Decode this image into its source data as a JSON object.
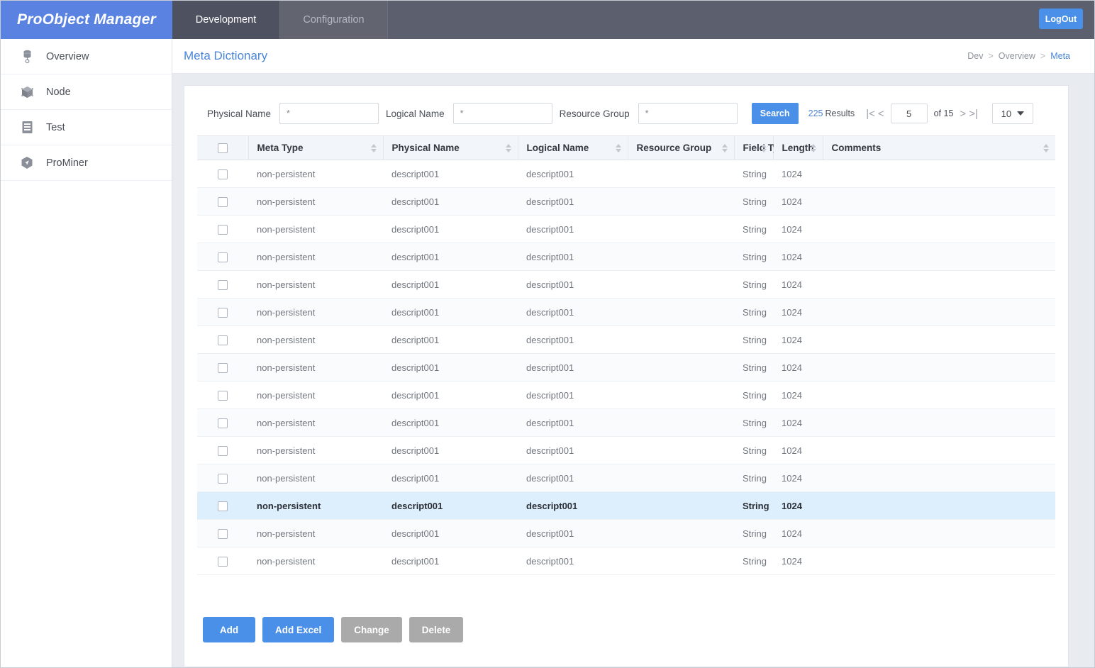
{
  "topbar": {
    "logo": "ProObject Manager",
    "tabs": [
      {
        "label": "Development",
        "active": true
      },
      {
        "label": "Configuration",
        "active": false
      }
    ],
    "logout_label": "LogOut",
    "accent_color": "#4a90e8",
    "logo_bg": "#5a82e0",
    "bar_bg": "#5b5f6e"
  },
  "sidebar": {
    "items": [
      {
        "label": "Overview",
        "icon": "database-icon"
      },
      {
        "label": "Node",
        "icon": "cube-icon"
      },
      {
        "label": "Test",
        "icon": "list-document-icon"
      },
      {
        "label": "ProMiner",
        "icon": "shield-icon"
      }
    ]
  },
  "content_header": {
    "title": "Meta Dictionary",
    "breadcrumb": [
      {
        "label": "Dev",
        "current": false
      },
      {
        "label": "Overview",
        "current": false
      },
      {
        "label": "Meta",
        "current": true
      }
    ],
    "separator": ">"
  },
  "filters": {
    "physical_name_label": "Physical Name",
    "physical_name_value": "*",
    "logical_name_label": "Logical Name",
    "logical_name_value": "*",
    "resource_group_label": "Resource Group",
    "resource_group_value": "*",
    "search_label": "Search"
  },
  "pagination": {
    "results_count": "225",
    "results_label": "Results",
    "first_icon": "|<",
    "prev_icon": "<",
    "page_value": "5",
    "of_label": "of 15",
    "total_pages": "15",
    "next_icon": ">",
    "last_icon": ">|",
    "page_size": "10"
  },
  "table": {
    "columns": [
      {
        "label": "Meta  Type",
        "sortable": true
      },
      {
        "label": "Physical  Name",
        "sortable": true
      },
      {
        "label": "Logical  Name",
        "sortable": true
      },
      {
        "label": "Resource  Group",
        "sortable": true
      },
      {
        "label": "Field  Type",
        "sortable": true
      },
      {
        "label": "Length",
        "sortable": true
      },
      {
        "label": "Comments",
        "sortable": true
      }
    ],
    "rows": [
      {
        "meta_type": "non-persistent",
        "physical_name": "descript001",
        "logical_name": "descript001",
        "resource_group": "",
        "field_type": "String",
        "length": "1024",
        "comments": "",
        "selected": false
      },
      {
        "meta_type": "non-persistent",
        "physical_name": "descript001",
        "logical_name": "descript001",
        "resource_group": "",
        "field_type": "String",
        "length": "1024",
        "comments": "",
        "selected": false
      },
      {
        "meta_type": "non-persistent",
        "physical_name": "descript001",
        "logical_name": "descript001",
        "resource_group": "",
        "field_type": "String",
        "length": "1024",
        "comments": "",
        "selected": false
      },
      {
        "meta_type": "non-persistent",
        "physical_name": "descript001",
        "logical_name": "descript001",
        "resource_group": "",
        "field_type": "String",
        "length": "1024",
        "comments": "",
        "selected": false
      },
      {
        "meta_type": "non-persistent",
        "physical_name": "descript001",
        "logical_name": "descript001",
        "resource_group": "",
        "field_type": "String",
        "length": "1024",
        "comments": "",
        "selected": false
      },
      {
        "meta_type": "non-persistent",
        "physical_name": "descript001",
        "logical_name": "descript001",
        "resource_group": "",
        "field_type": "String",
        "length": "1024",
        "comments": "",
        "selected": false
      },
      {
        "meta_type": "non-persistent",
        "physical_name": "descript001",
        "logical_name": "descript001",
        "resource_group": "",
        "field_type": "String",
        "length": "1024",
        "comments": "",
        "selected": false
      },
      {
        "meta_type": "non-persistent",
        "physical_name": "descript001",
        "logical_name": "descript001",
        "resource_group": "",
        "field_type": "String",
        "length": "1024",
        "comments": "",
        "selected": false
      },
      {
        "meta_type": "non-persistent",
        "physical_name": "descript001",
        "logical_name": "descript001",
        "resource_group": "",
        "field_type": "String",
        "length": "1024",
        "comments": "",
        "selected": false
      },
      {
        "meta_type": "non-persistent",
        "physical_name": "descript001",
        "logical_name": "descript001",
        "resource_group": "",
        "field_type": "String",
        "length": "1024",
        "comments": "",
        "selected": false
      },
      {
        "meta_type": "non-persistent",
        "physical_name": "descript001",
        "logical_name": "descript001",
        "resource_group": "",
        "field_type": "String",
        "length": "1024",
        "comments": "",
        "selected": false
      },
      {
        "meta_type": "non-persistent",
        "physical_name": "descript001",
        "logical_name": "descript001",
        "resource_group": "",
        "field_type": "String",
        "length": "1024",
        "comments": "",
        "selected": false
      },
      {
        "meta_type": "non-persistent",
        "physical_name": "descript001",
        "logical_name": "descript001",
        "resource_group": "",
        "field_type": "String",
        "length": "1024",
        "comments": "",
        "selected": true
      },
      {
        "meta_type": "non-persistent",
        "physical_name": "descript001",
        "logical_name": "descript001",
        "resource_group": "",
        "field_type": "String",
        "length": "1024",
        "comments": "",
        "selected": false
      },
      {
        "meta_type": "non-persistent",
        "physical_name": "descript001",
        "logical_name": "descript001",
        "resource_group": "",
        "field_type": "String",
        "length": "1024",
        "comments": "",
        "selected": false
      }
    ]
  },
  "footer": {
    "buttons": [
      {
        "label": "Add",
        "state": "primary"
      },
      {
        "label": "Add Excel",
        "state": "primary"
      },
      {
        "label": "Change",
        "state": "disabled"
      },
      {
        "label": "Delete",
        "state": "disabled"
      }
    ]
  }
}
